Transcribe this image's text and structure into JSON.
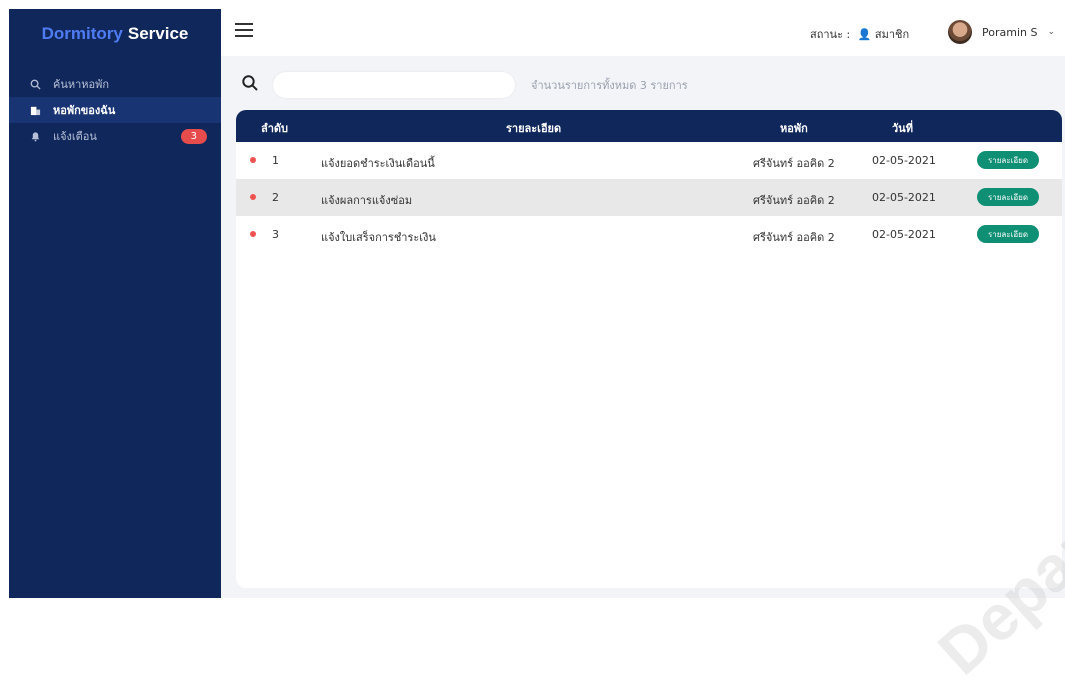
{
  "brand": {
    "part1": "Dormitory",
    "part2": "Service"
  },
  "sidebar": {
    "items": [
      {
        "icon": "search-icon",
        "label": "ค้นหาหอพัก"
      },
      {
        "icon": "building-icon",
        "label": "หอพักของฉัน"
      },
      {
        "icon": "bell-icon",
        "label": "แจ้งเตือน",
        "badge": "3"
      }
    ]
  },
  "topbar": {
    "status_label": "สถานะ :",
    "status_value": "สมาชิก",
    "user_name": "Poramin S"
  },
  "main": {
    "search_placeholder": "",
    "count_text": "จำนวนรายการทั้งหมด 3 รายการ",
    "table": {
      "headers": [
        "ลำดับ",
        "รายละเอียด",
        "หอพัก",
        "วันที่",
        ""
      ],
      "rows": [
        {
          "no": "1",
          "detail": "แจ้งยอดชำระเงินเดือนนี้",
          "dorm": "ศรีจันทร์ ออคิด 2",
          "date": "02-05-2021",
          "button": "รายละเอียด"
        },
        {
          "no": "2",
          "detail": "แจ้งผลการแจ้งซ่อม",
          "dorm": "ศรีจันทร์ ออคิด 2",
          "date": "02-05-2021",
          "button": "รายละเอียด"
        },
        {
          "no": "3",
          "detail": "แจ้งใบเสร็จการชำระเงิน",
          "dorm": "ศรีจันทร์ ออคิด 2",
          "date": "02-05-2021",
          "button": "รายละเอียด"
        }
      ]
    }
  },
  "watermark": "Department University",
  "colors": {
    "sidebar": "#10275c",
    "accent": "#4f7cf2",
    "button": "#0f8f74",
    "badge": "#e74c4c",
    "dot": "#ef5350"
  }
}
